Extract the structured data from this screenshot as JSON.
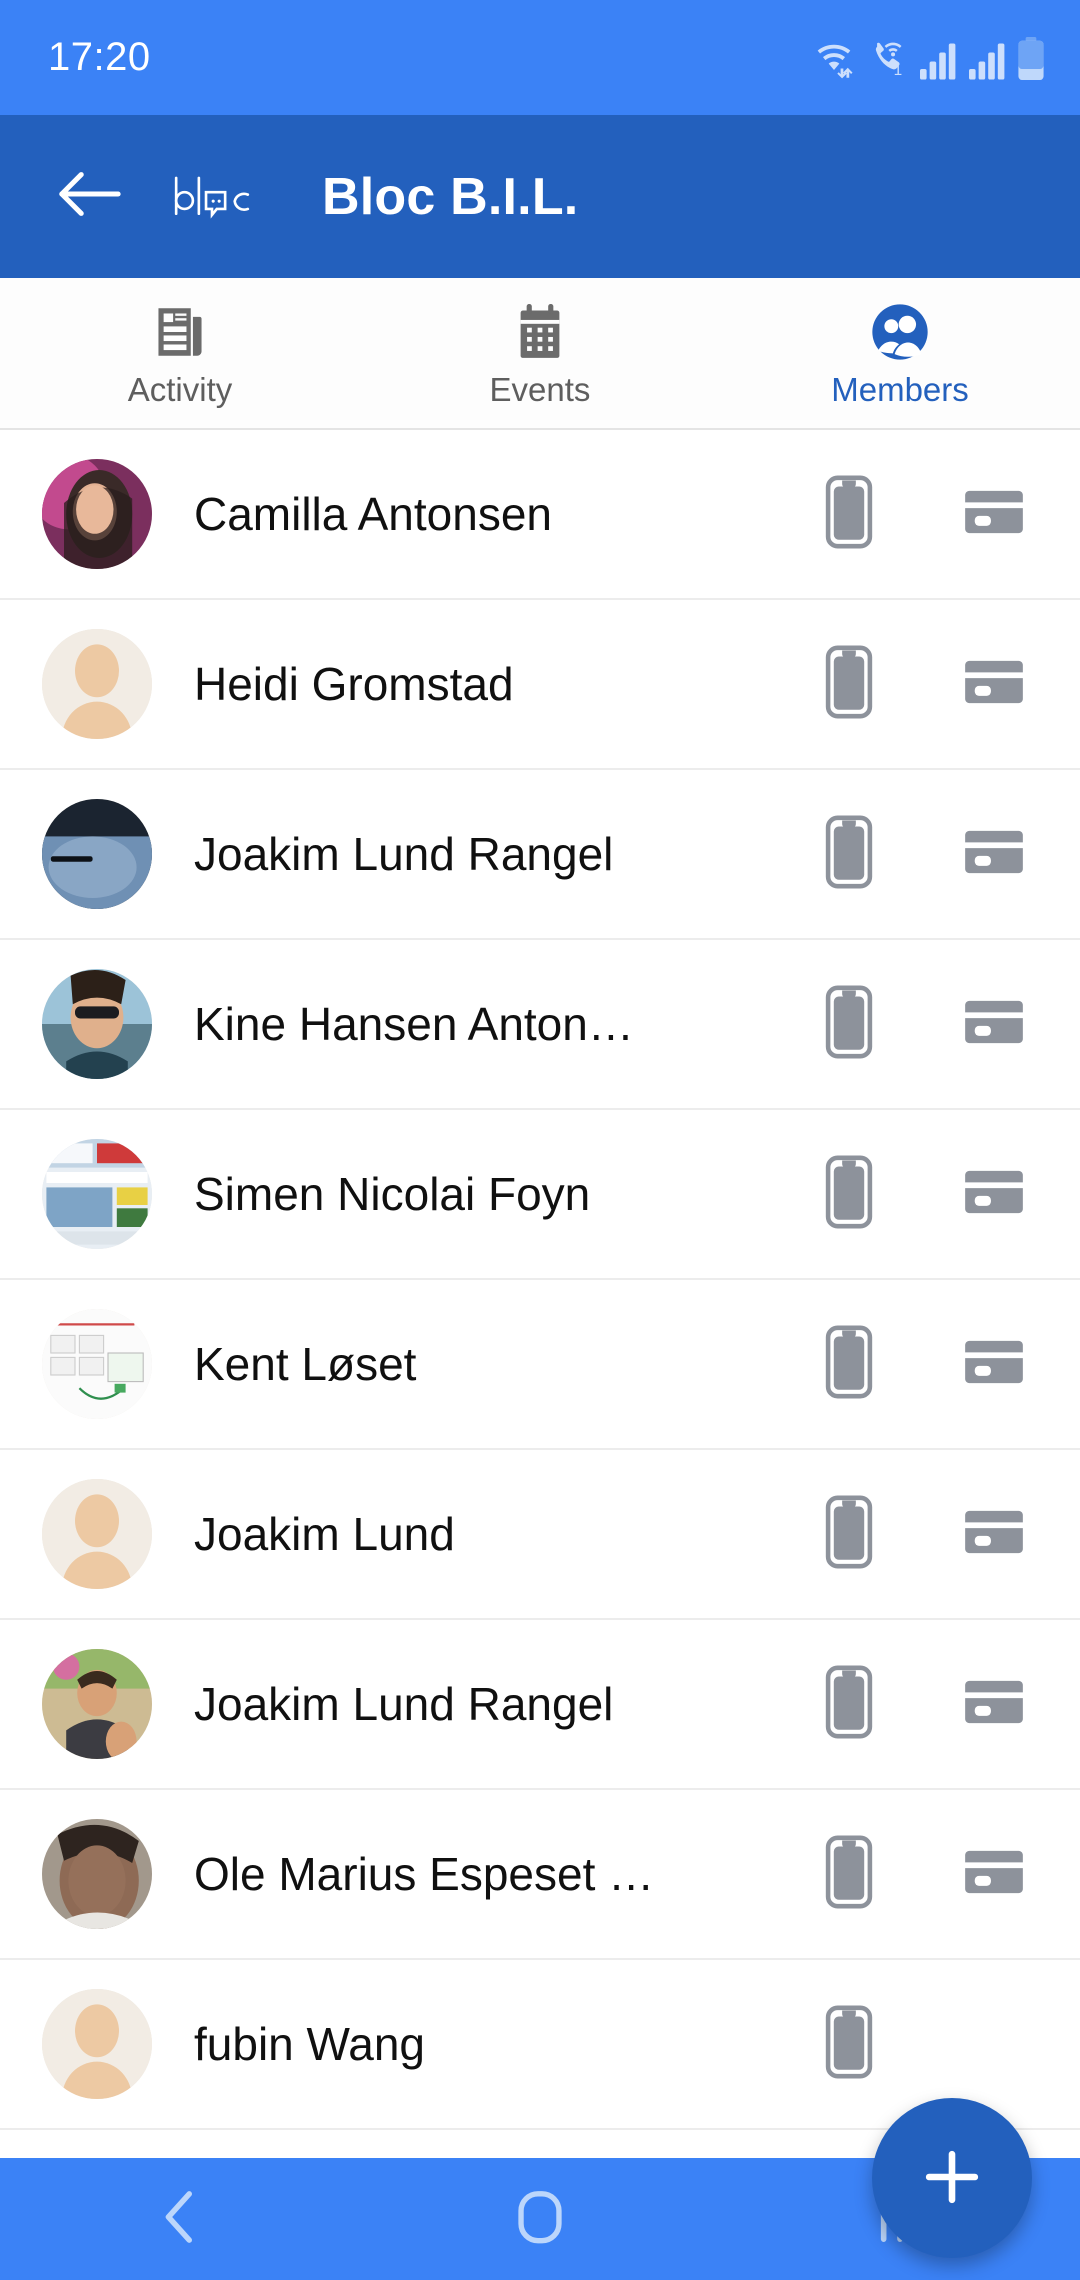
{
  "status_bar": {
    "time": "17:20",
    "icons": [
      "wifi-data-icon",
      "vowifi-call-icon",
      "signal-sim1-icon",
      "signal-sim2-icon",
      "battery-icon"
    ],
    "sim_badge": "1",
    "background_color": "#3b82f6"
  },
  "app_bar": {
    "back_label": "back-arrow",
    "brand": "bloc",
    "title": "Bloc B.I.L.",
    "background_color": "#2360bd"
  },
  "tabs": [
    {
      "label": "Activity",
      "icon": "news-article-icon",
      "active": false
    },
    {
      "label": "Events",
      "icon": "calendar-icon",
      "active": false
    },
    {
      "label": "Members",
      "icon": "people-group-icon",
      "active": true
    }
  ],
  "accent_color": "#2360bd",
  "inactive_tab_color": "#5e5e5e",
  "row_actions": {
    "phone_icon": "smartphone-icon",
    "card_icon": "credit-card-icon",
    "icon_color": "#8d929b"
  },
  "members": [
    {
      "name": "Camilla Antonsen",
      "avatar": "photo-woman-headphones",
      "has_phone": true,
      "has_card": true
    },
    {
      "name": "Heidi Gromstad",
      "avatar": "default-avatar",
      "has_phone": true,
      "has_card": true
    },
    {
      "name": "Joakim Lund Rangel",
      "avatar": "photo-dark-blue",
      "has_phone": true,
      "has_card": true
    },
    {
      "name": "Kine Hansen Anton…",
      "avatar": "photo-woman-sunglasses",
      "has_phone": true,
      "has_card": true
    },
    {
      "name": "Simen Nicolai Foyn",
      "avatar": "photo-screenshot-news",
      "has_phone": true,
      "has_card": true
    },
    {
      "name": "Kent Løset",
      "avatar": "photo-diagram",
      "has_phone": true,
      "has_card": true
    },
    {
      "name": "Joakim Lund",
      "avatar": "default-avatar",
      "has_phone": true,
      "has_card": true
    },
    {
      "name": "Joakim Lund Rangel",
      "avatar": "photo-man-outdoor",
      "has_phone": true,
      "has_card": true
    },
    {
      "name": "Ole Marius Espeset …",
      "avatar": "photo-man-face",
      "has_phone": true,
      "has_card": true
    },
    {
      "name": "fubin Wang",
      "avatar": "default-avatar",
      "has_phone": true,
      "has_card": false
    }
  ],
  "fab": {
    "label": "+",
    "action": "add-member",
    "color": "#2360bd"
  },
  "nav_bar": {
    "buttons": [
      "back-nav-icon",
      "home-nav-icon",
      "recents-nav-icon"
    ],
    "background_color": "#3b82f6"
  }
}
